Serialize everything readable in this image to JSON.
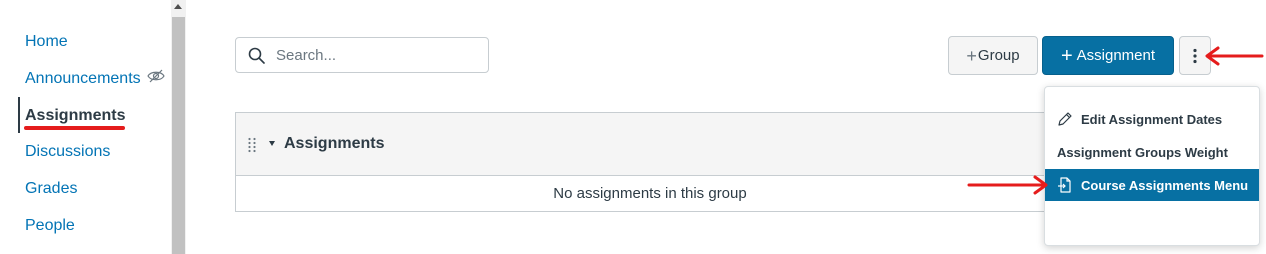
{
  "sidebar": {
    "items": [
      {
        "label": "Home"
      },
      {
        "label": "Announcements"
      },
      {
        "label": "Assignments"
      },
      {
        "label": "Discussions"
      },
      {
        "label": "Grades"
      },
      {
        "label": "People"
      }
    ],
    "active_index": 2
  },
  "search": {
    "placeholder": "Search...",
    "value": ""
  },
  "toolbar": {
    "group_label": "Group",
    "assignment_label": "Assignment"
  },
  "group": {
    "title": "Assignments",
    "empty_message": "No assignments in this group"
  },
  "menu": {
    "items": [
      {
        "label": "Edit Assignment Dates",
        "icon": "pencil-icon"
      },
      {
        "label": "Assignment Groups Weight",
        "icon": ""
      },
      {
        "label": "Course Assignments Menu",
        "icon": "external-doc-icon",
        "highlighted": true
      }
    ]
  },
  "colors": {
    "link": "#0374b5",
    "primary_button": "#0770a3",
    "annotation": "#e51c1c"
  }
}
